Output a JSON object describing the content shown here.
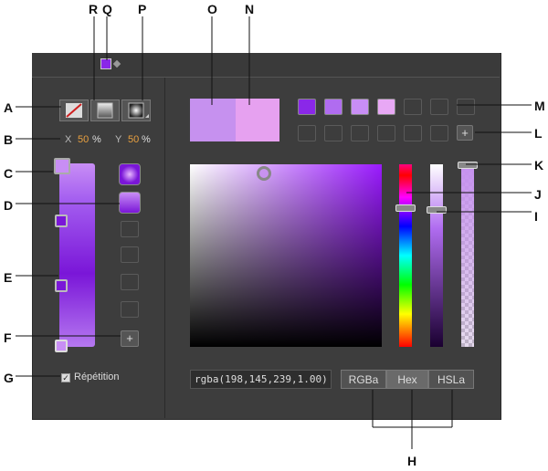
{
  "callouts": {
    "A": "A",
    "B": "B",
    "C": "C",
    "D": "D",
    "E": "E",
    "F": "F",
    "G": "G",
    "H": "H",
    "I": "I",
    "J": "J",
    "K": "K",
    "L": "L",
    "M": "M",
    "N": "N",
    "O": "O",
    "P": "P",
    "Q": "Q",
    "R": "R"
  },
  "left": {
    "x_label": "X",
    "x_value": "50",
    "x_unit": "%",
    "y_label": "Y",
    "y_value": "50",
    "y_unit": "%",
    "repeat_label": "Répétition",
    "add_glyph": "+"
  },
  "right": {
    "color_value": "rgba(198,145,239,1.00)",
    "tabs": [
      "RGBa",
      "Hex",
      "HSLa"
    ],
    "add_glyph": "+"
  },
  "colors": {
    "preview_old": "#c691ef",
    "preview_new": "#e6a1f0",
    "swatches": [
      "#8a28e8",
      "#b06cf0",
      "#c88ef5",
      "#e8a8f5"
    ],
    "gradient_start": "#c88ef5",
    "gradient_end": "#7a16d8",
    "panel_bg": "#3d3d3d"
  }
}
